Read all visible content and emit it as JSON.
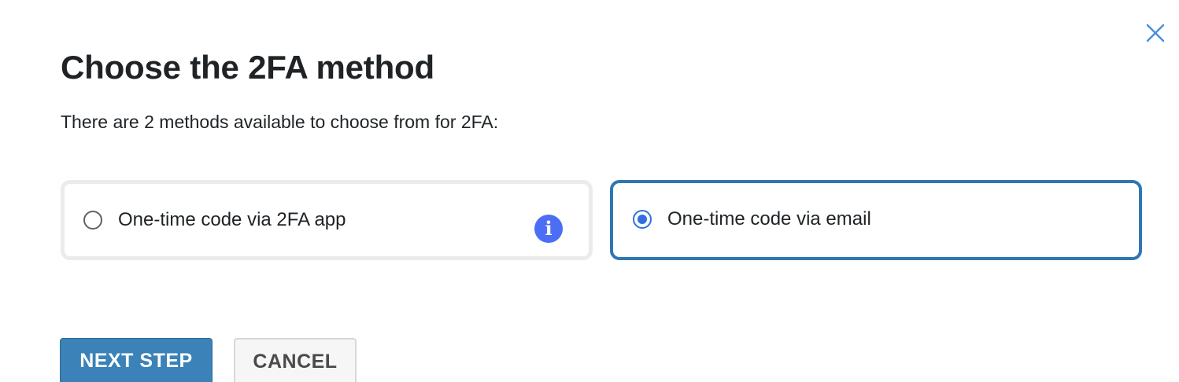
{
  "dialog": {
    "title": "Choose the 2FA method",
    "subtitle": "There are 2 methods available to choose from for 2FA:",
    "close_icon": "close-icon"
  },
  "options": [
    {
      "label": "One-time code via 2FA app",
      "selected": false,
      "has_info": true,
      "info_glyph": "i"
    },
    {
      "label": "One-time code via email",
      "selected": true,
      "has_info": false
    }
  ],
  "actions": {
    "next_label": "NEXT STEP",
    "cancel_label": "CANCEL"
  },
  "colors": {
    "accent": "#3a82b8",
    "selected_border": "#2f77b4",
    "radio_selected": "#2f6fe0",
    "info_badge": "#4c6ef5",
    "close_icon": "#4a90d9"
  }
}
